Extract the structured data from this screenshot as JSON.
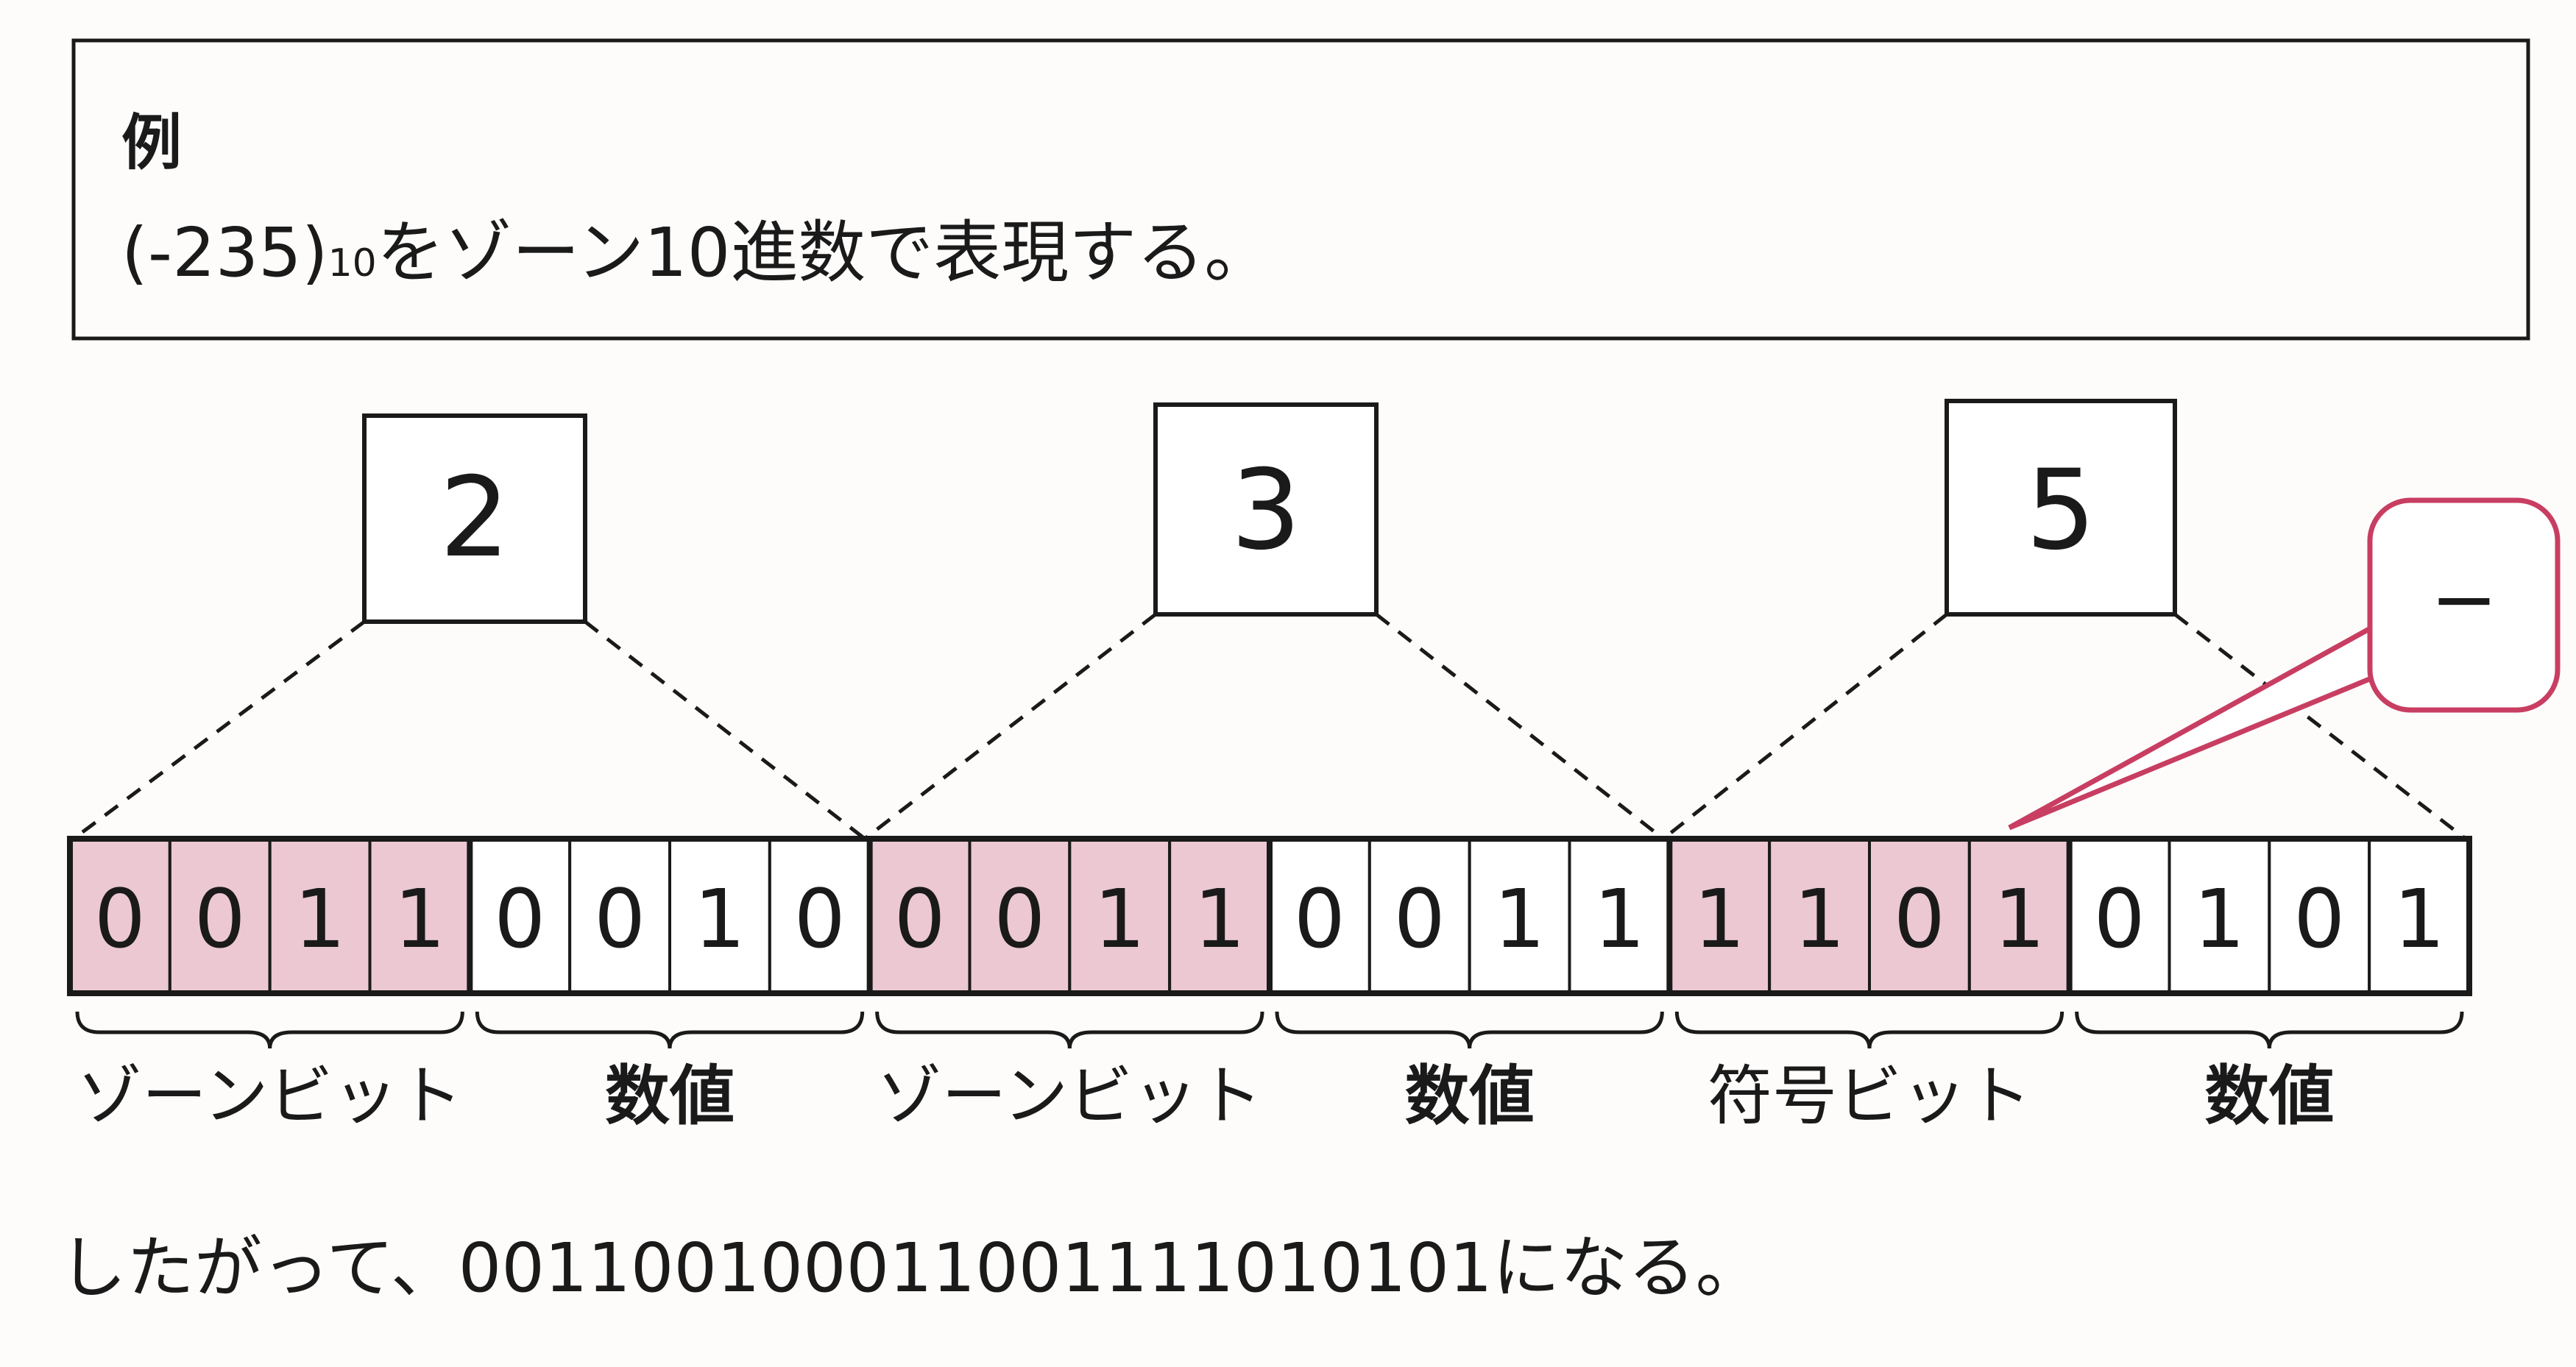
{
  "example_box": {
    "title": "例",
    "statement_prefix": "(-235)",
    "statement_subscript": "10",
    "statement_suffix": "をゾーン10進数で表現する。"
  },
  "digit_boxes": [
    "2",
    "3",
    "5"
  ],
  "sign_callout": "−",
  "bits": [
    "0",
    "0",
    "1",
    "1",
    "0",
    "0",
    "1",
    "0",
    "0",
    "0",
    "1",
    "1",
    "0",
    "0",
    "1",
    "1",
    "1",
    "1",
    "0",
    "1",
    "0",
    "1",
    "0",
    "1"
  ],
  "groups": [
    {
      "label": "ゾーンビット",
      "shaded": true
    },
    {
      "label": "数値",
      "shaded": false
    },
    {
      "label": "ゾーンビット",
      "shaded": true
    },
    {
      "label": "数値",
      "shaded": false
    },
    {
      "label": "符号ビット",
      "shaded": true
    },
    {
      "label": "数値",
      "shaded": false
    }
  ],
  "conclusion": "したがって、001100100011001111010101になる。",
  "colors": {
    "shade": "#ecc8d2",
    "callout_border": "#c83e62",
    "ink": "#1a1a1a"
  }
}
